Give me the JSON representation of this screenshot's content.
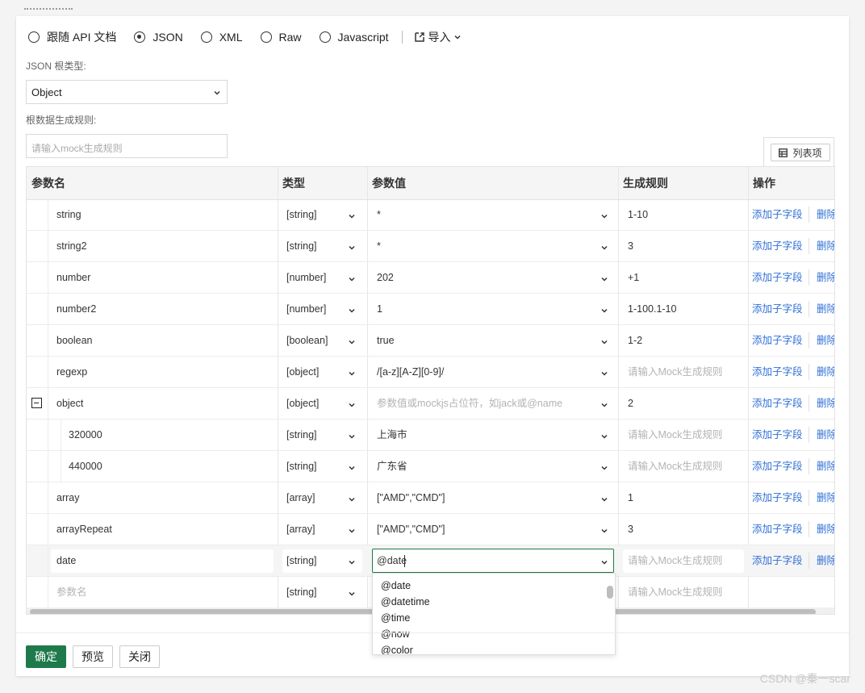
{
  "format_options": {
    "items": [
      "跟随 API 文档",
      "JSON",
      "XML",
      "Raw",
      "Javascript"
    ],
    "selected": "JSON",
    "import_label": "导入"
  },
  "root_type": {
    "label": "JSON 根类型:",
    "value": "Object"
  },
  "root_rule": {
    "label": "根数据生成规则:",
    "placeholder": "请输入mock生成规则"
  },
  "columns_button": "列表项",
  "table": {
    "headers": [
      "参数名",
      "类型",
      "参数值",
      "生成规则",
      "操作"
    ],
    "rows": [
      {
        "name": "string",
        "type": "[string]",
        "value": "*",
        "rule": "1-10"
      },
      {
        "name": "string2",
        "type": "[string]",
        "value": "*",
        "rule": "3"
      },
      {
        "name": "number",
        "type": "[number]",
        "value": "202",
        "rule": "+1"
      },
      {
        "name": "number2",
        "type": "[number]",
        "value": "1",
        "rule": "1-100.1-10"
      },
      {
        "name": "boolean",
        "type": "[boolean]",
        "value": "true",
        "rule": "1-2"
      },
      {
        "name": "regexp",
        "type": "[object]",
        "value": "/[a-z][A-Z][0-9]/",
        "rule": "请输入Mock生成规则"
      },
      {
        "name": "object",
        "type": "[object]",
        "value": "参数值或mockjs占位符，如jack或@name",
        "rule": "2"
      },
      {
        "name": "320000",
        "type": "[string]",
        "value": "上海市",
        "rule": "请输入Mock生成规则"
      },
      {
        "name": "440000",
        "type": "[string]",
        "value": "广东省",
        "rule": "请输入Mock生成规则"
      },
      {
        "name": "array",
        "type": "[array]",
        "value": "[\"AMD\",\"CMD\"]",
        "rule": "1"
      },
      {
        "name": "arrayRepeat",
        "type": "[array]",
        "value": "[\"AMD\",\"CMD\"]",
        "rule": "3"
      },
      {
        "name": "date",
        "type": "[string]",
        "value": "@date",
        "rule": "请输入Mock生成规则"
      },
      {
        "name": "参数名",
        "type": "[string]",
        "value": "",
        "rule": "请输入Mock生成规则"
      }
    ],
    "actions": {
      "add_child": "添加子字段",
      "delete": "删除"
    }
  },
  "dropdown": {
    "options": [
      "@date",
      "@datetime",
      "@time",
      "@now",
      "@color"
    ]
  },
  "footer": {
    "confirm": "确定",
    "preview": "预览",
    "close": "关闭"
  },
  "watermark": "CSDN @秦一scar"
}
